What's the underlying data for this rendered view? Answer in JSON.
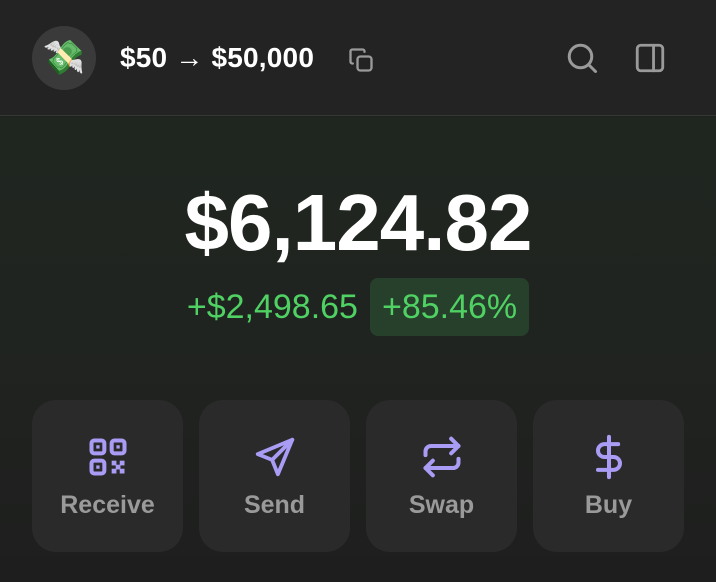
{
  "header": {
    "avatar_emoji": "💸",
    "wallet_name": "$50 → $50,000",
    "icons": {
      "copy": "copy-icon",
      "search": "search-icon",
      "panel": "sidebar-panel-icon"
    }
  },
  "portfolio": {
    "balance": "$6,124.82",
    "change_amount": "+$2,498.65",
    "change_percent": "+85.46%",
    "positive_color": "#4fd163"
  },
  "actions": [
    {
      "label": "Receive",
      "icon": "qr-code-icon"
    },
    {
      "label": "Send",
      "icon": "send-icon"
    },
    {
      "label": "Swap",
      "icon": "swap-icon"
    },
    {
      "label": "Buy",
      "icon": "dollar-icon"
    }
  ],
  "colors": {
    "accent": "#a99cf4",
    "background": "#1f211f",
    "card": "#2a2a2a"
  }
}
